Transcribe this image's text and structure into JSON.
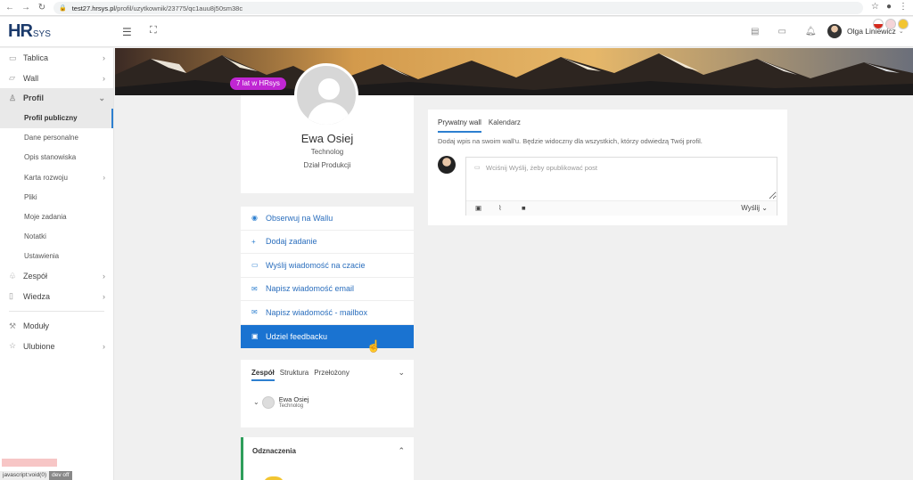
{
  "browser": {
    "url_host": "test27.hrsys.pl",
    "url_path": "/profil/uzytkownik/23775/qc1auu8j50sm38c"
  },
  "header": {
    "logo_main": "HR",
    "logo_sub": "SYS",
    "user_name": "Olga Liniewicz"
  },
  "sidebar": {
    "items": [
      {
        "label": "Tablica",
        "icon": "monitor-icon"
      },
      {
        "label": "Wall",
        "icon": "folder-icon"
      },
      {
        "label": "Profil",
        "icon": "user-icon"
      },
      {
        "label": "Zespół",
        "icon": "team-icon"
      },
      {
        "label": "Wiedza",
        "icon": "book-icon"
      },
      {
        "label": "Moduły",
        "icon": "wrench-icon"
      },
      {
        "label": "Ulubione",
        "icon": "star-icon"
      }
    ],
    "profil_sub": [
      "Profil publiczny",
      "Dane personalne",
      "Opis stanowiska",
      "Karta rozwoju",
      "Pliki",
      "Moje zadania",
      "Notatki",
      "Ustawienia"
    ],
    "status_text": "javascript:void(0)",
    "dev_label": "dev off"
  },
  "profile": {
    "years_badge": "7 lat w HRsys",
    "name": "Ewa Osiej",
    "role": "Technolog",
    "department": "Dział Produkcji"
  },
  "actions": [
    "Obserwuj na Wallu",
    "Dodaj zadanie",
    "Wyślij wiadomość na czacie",
    "Napisz wiadomość email",
    "Napisz wiadomość - mailbox",
    "Udziel feedbacku"
  ],
  "team": {
    "tabs": [
      "Zespół",
      "Struktura",
      "Przełożony"
    ],
    "member_name": "Ewa Osiej",
    "member_role": "Technolog"
  },
  "honors": {
    "title": "Odznaczenia"
  },
  "wall": {
    "tabs": [
      "Prywatny wall",
      "Kalendarz"
    ],
    "hint": "Dodaj wpis na swoim wall'u. Będzie widoczny dla wszystkich, którzy odwiedzą Twój profil.",
    "placeholder": "Wciśnij Wyślij, żeby opublikować post",
    "send_label": "Wyślij"
  },
  "colors": {
    "accent": "#1a73d1",
    "badge": "#c026d3",
    "honors_bar": "#2e9e5b"
  }
}
